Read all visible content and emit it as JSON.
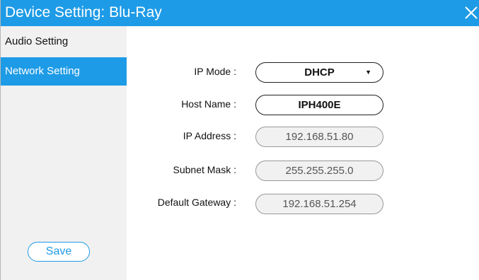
{
  "titlebar": {
    "title": "Device Setting: Blu-Ray"
  },
  "sidebar": {
    "items": [
      {
        "label": "Audio Setting"
      },
      {
        "label": "Network Setting"
      }
    ],
    "save_label": "Save"
  },
  "network": {
    "ip_mode": {
      "label": "IP Mode :",
      "value": "DHCP"
    },
    "host_name": {
      "label": "Host Name :",
      "value": "IPH400E"
    },
    "ip_address": {
      "label": "IP Address :",
      "value": "192.168.51.80"
    },
    "subnet_mask": {
      "label": "Subnet Mask :",
      "value": "255.255.255.0"
    },
    "default_gateway": {
      "label": "Default Gateway :",
      "value": "192.168.51.254"
    }
  },
  "colors": {
    "accent": "#1e9be6",
    "sidebar_bg": "#f1f1f1",
    "readonly_bg": "#f1f1f1"
  },
  "icons": {
    "close": "close-icon",
    "dropdown": "chevron-down-icon"
  }
}
